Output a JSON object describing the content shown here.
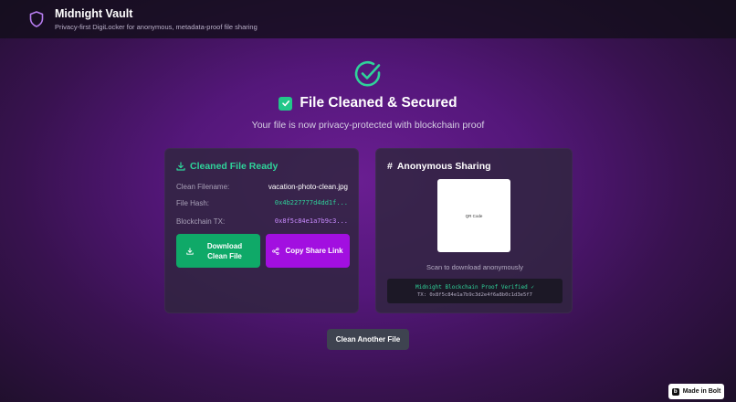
{
  "header": {
    "title": "Midnight Vault",
    "subtitle": "Privacy-first DigiLocker for anonymous, metadata-proof file sharing",
    "logo_icon": "shield-icon"
  },
  "status": {
    "icon": "check-circle-icon",
    "title": "File Cleaned & Secured",
    "subtitle": "Your file is now privacy-protected with blockchain proof"
  },
  "cleaned_card": {
    "heading": "Cleaned File Ready",
    "rows": [
      {
        "label": "Clean Filename:",
        "value": "vacation-photo-clean.jpg"
      },
      {
        "label": "File Hash:",
        "value": "0x4b227777d4dd1f..."
      },
      {
        "label": "Blockchain TX:",
        "value": "0x8f5c84e1a7b9c3..."
      }
    ],
    "download_label": "Download Clean File",
    "share_label": "Copy Share Link"
  },
  "sharing_card": {
    "heading": "Anonymous Sharing",
    "qr_label": "QR Code",
    "scan_text": "Scan to download anonymously",
    "proof_title": "Midnight Blockchain Proof Verified ✓",
    "proof_tx": "TX: 0x8f5c84e1a7b9c3d2e4f6a8b0c1d3e5f7"
  },
  "actions": {
    "clean_again_label": "Clean Another File"
  },
  "badge": {
    "label": "Made in Bolt"
  },
  "colors": {
    "accent_green": "#2fd39a",
    "download_green": "#0fa968",
    "share_purple": "#a20fe0",
    "hash_purple": "#c98cff"
  }
}
